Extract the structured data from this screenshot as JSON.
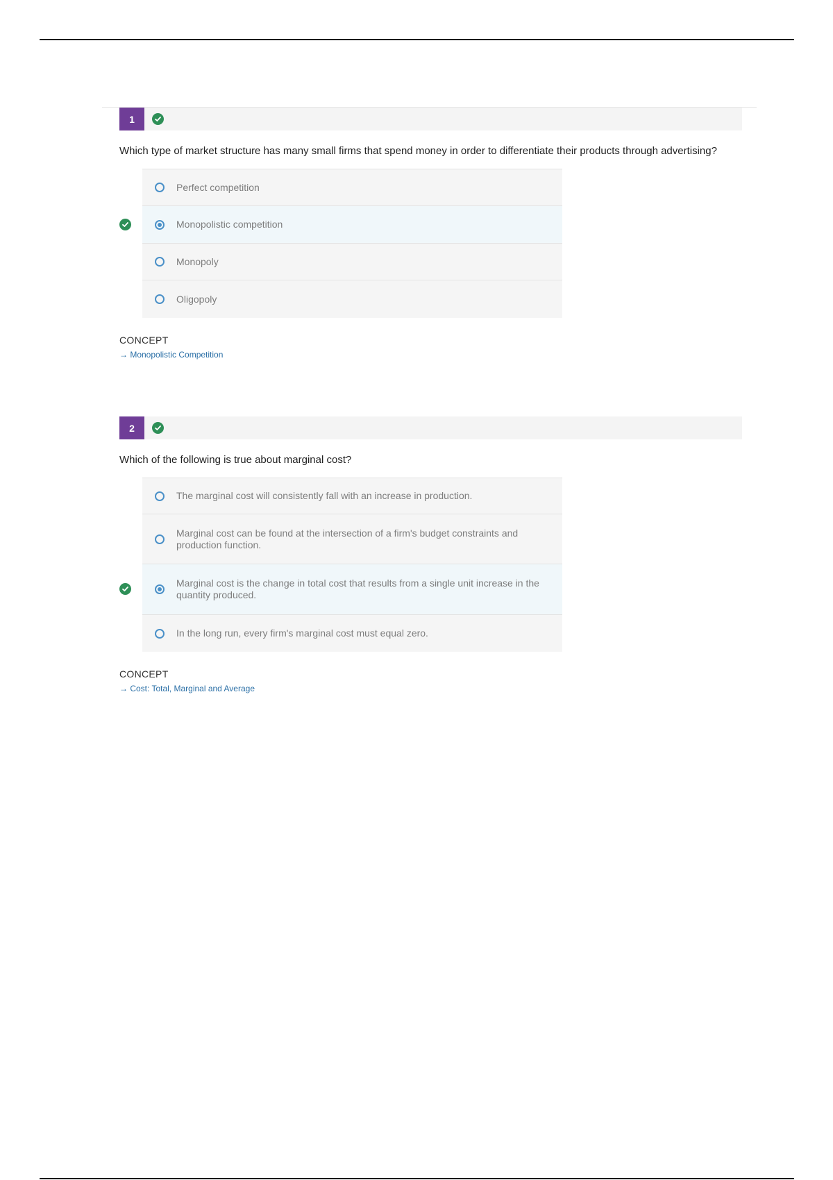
{
  "questions": [
    {
      "number": "1",
      "status_icon": "check-circle-icon",
      "prompt": "Which type of market structure has many small firms that spend money in order to differentiate their products through advertising?",
      "options": [
        {
          "text": "Perfect competition",
          "selected": false,
          "correct": false
        },
        {
          "text": "Monopolistic competition",
          "selected": true,
          "correct": true
        },
        {
          "text": "Monopoly",
          "selected": false,
          "correct": false
        },
        {
          "text": "Oligopoly",
          "selected": false,
          "correct": false
        }
      ],
      "concept_label": "CONCEPT",
      "concept_link": "→ Monopolistic Competition"
    },
    {
      "number": "2",
      "status_icon": "check-circle-icon",
      "prompt": "Which of the following is true about marginal cost?",
      "options": [
        {
          "text": "The marginal cost will consistently fall with an increase in production.",
          "selected": false,
          "correct": false
        },
        {
          "text": "Marginal cost can be found at the intersection of a firm's budget constraints and production function.",
          "selected": false,
          "correct": false
        },
        {
          "text": "Marginal cost is the change in total cost that results from a single unit increase in the quantity produced.",
          "selected": true,
          "correct": true
        },
        {
          "text": "In the long run, every firm's marginal cost must equal zero.",
          "selected": false,
          "correct": false
        }
      ],
      "concept_label": "CONCEPT",
      "concept_link": "→ Cost: Total, Marginal and Average"
    }
  ],
  "colors": {
    "accent_purple": "#6f3d97",
    "correct_green": "#2e8f57",
    "radio_blue": "#4a90c8",
    "link_blue": "#2a6fa6"
  }
}
